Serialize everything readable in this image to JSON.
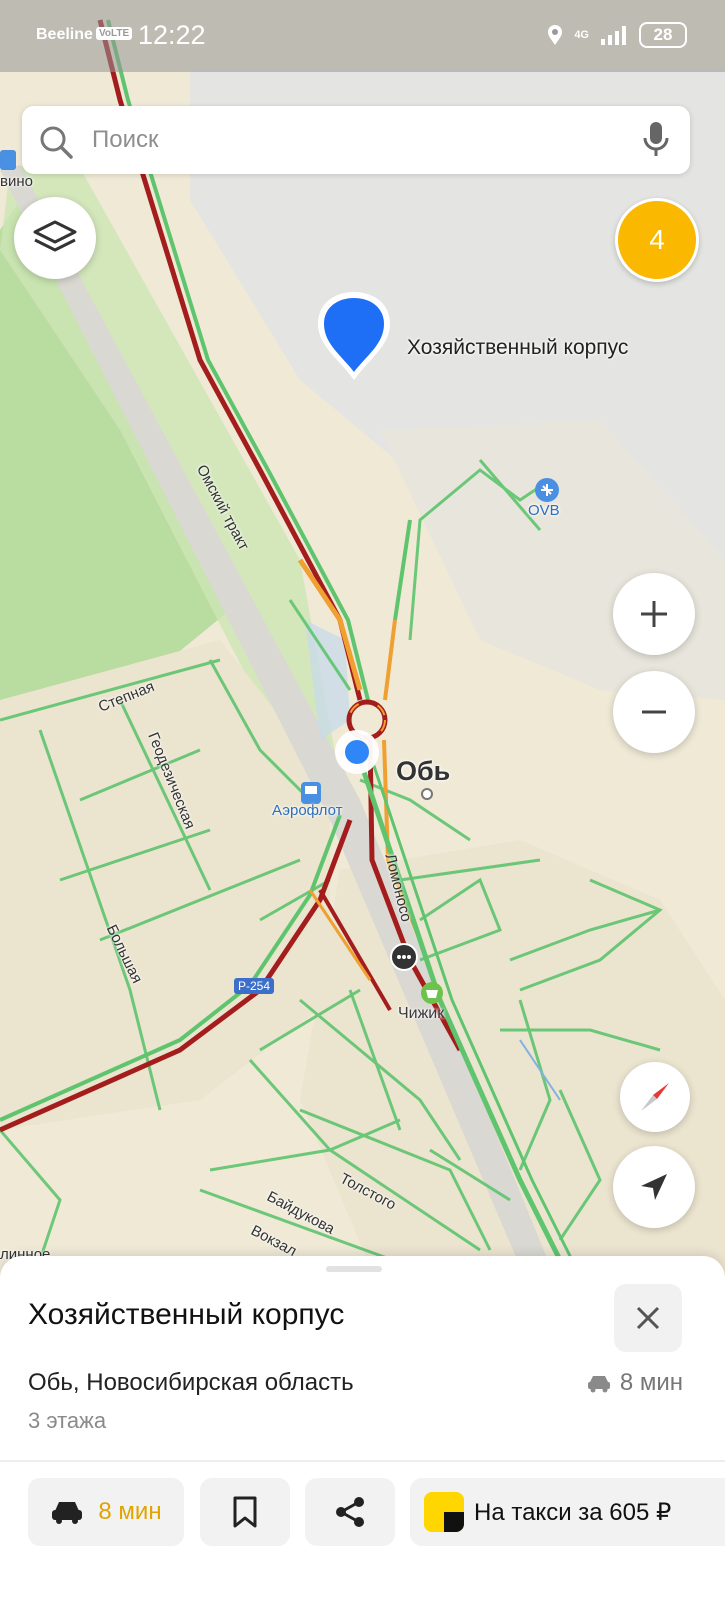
{
  "status_bar": {
    "carrier": "Beeline",
    "volte": "VoLTE",
    "time": "12:22",
    "network": "4G",
    "battery": "28"
  },
  "search": {
    "placeholder": "Поиск"
  },
  "notifications_badge": "4",
  "map": {
    "pin_label": "Хозяйственный корпус",
    "labels": {
      "top_left": "вино",
      "airport": "OVB",
      "city": "Обь",
      "station": "Аэрофлот",
      "shop": "Чижик",
      "road_badge": "Р-254",
      "street_omsky": "Омский тракт",
      "street_stepnaya": "Степная",
      "street_geodez": "Геодезическая",
      "street_bolshaya": "Большая",
      "street_lomonosova": "Ломоносо",
      "street_tolstogo": "Толстого",
      "street_baidukova": "Байдукова",
      "street_vokzal": "Вокзал",
      "bottom_left": "линное"
    }
  },
  "card": {
    "title": "Хозяйственный корпус",
    "address": "Обь, Новосибирская область",
    "floors": "3 этажа",
    "drive_time": "8 мин"
  },
  "actions": {
    "route_time": "8 мин",
    "taxi": "На такси за 605 ₽"
  },
  "colors": {
    "accent_yellow": "#fbb800",
    "pin_blue": "#1e6ff5",
    "traffic_green": "#5ec46e",
    "traffic_red": "#a31d1d",
    "traffic_orange": "#f0a030"
  }
}
